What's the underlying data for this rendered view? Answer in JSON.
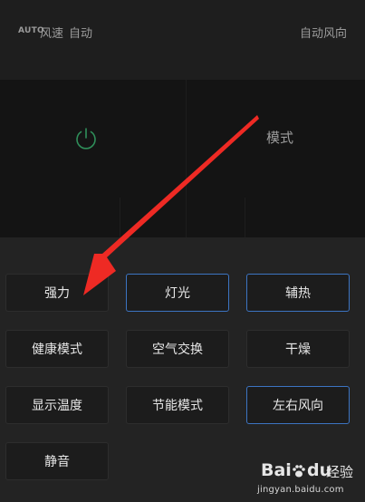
{
  "status": {
    "auto_badge": "AUTO",
    "fan_label": "风速",
    "fan_value": "自动",
    "swing_label": "自动风向"
  },
  "panel": {
    "power_icon": "power-icon",
    "mode_label": "模式"
  },
  "buttons": [
    {
      "label": "强力",
      "active": false
    },
    {
      "label": "灯光",
      "active": true
    },
    {
      "label": "辅热",
      "active": true
    },
    {
      "label": "健康模式",
      "active": false
    },
    {
      "label": "空气交换",
      "active": false
    },
    {
      "label": "干燥",
      "active": false
    },
    {
      "label": "显示温度",
      "active": false
    },
    {
      "label": "节能模式",
      "active": false
    },
    {
      "label": "左右风向",
      "active": true
    },
    {
      "label": "静音",
      "active": false
    }
  ],
  "watermark": {
    "brand_bai": "Bai",
    "brand_du": "du",
    "brand_suffix": "经验",
    "url": "jingyan.baidu.com"
  },
  "colors": {
    "active_border": "#3c74c2",
    "power_icon": "#2f8f5a",
    "arrow": "#ee2a24"
  }
}
